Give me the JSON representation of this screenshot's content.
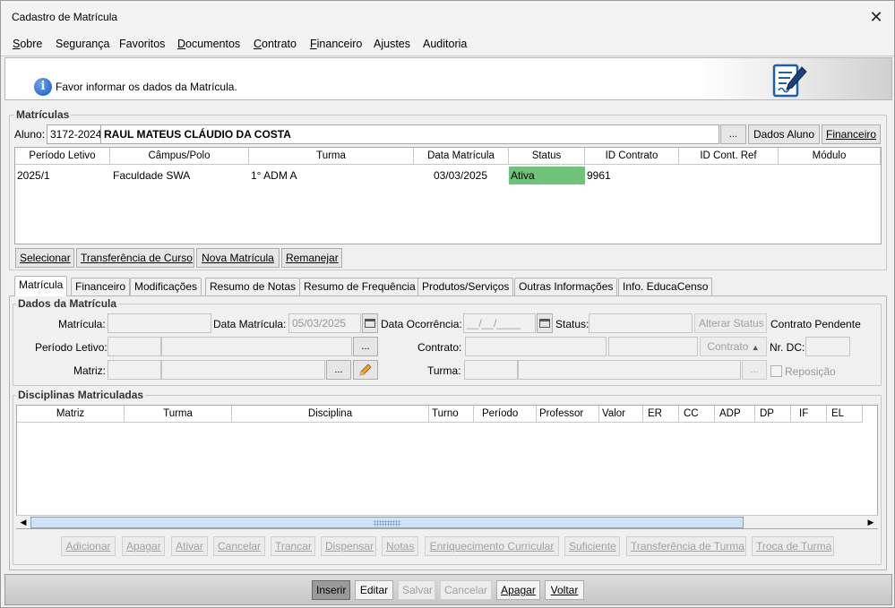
{
  "window": {
    "title": "Cadastro de Matrícula",
    "close_glyph": "✕"
  },
  "menu": [
    {
      "pre": "",
      "u": "S",
      "post": "obre"
    },
    {
      "pre": "Segurança",
      "u": "",
      "post": ""
    },
    {
      "pre": "Favoritos",
      "u": "",
      "post": ""
    },
    {
      "pre": "",
      "u": "D",
      "post": "ocumentos"
    },
    {
      "pre": "",
      "u": "C",
      "post": "ontrato"
    },
    {
      "pre": "",
      "u": "F",
      "post": "inanceiro"
    },
    {
      "pre": "Ajustes",
      "u": "",
      "post": ""
    },
    {
      "pre": "Auditoria",
      "u": "",
      "post": ""
    }
  ],
  "banner": {
    "info_glyph": "i",
    "message": "Favor informar os dados da Matrícula."
  },
  "matriculas": {
    "group_title": "Matrículas",
    "aluno_label": "Aluno:",
    "aluno_code": "3172-2024",
    "aluno_name": "RAUL MATEUS CLÁUDIO DA COSTA",
    "ellipsis": "...",
    "dados_aluno": "Dados Aluno",
    "financeiro_btn": "Financeiro",
    "columns": [
      "Período Letivo",
      "Câmpus/Polo",
      "Turma",
      "Data Matrícula",
      "Status",
      "ID Contrato",
      "ID Cont. Ref",
      "Módulo"
    ],
    "rows": [
      {
        "periodo": "2025/1",
        "campus": "Faculdade SWA",
        "turma": "1° ADM A",
        "data": "03/03/2025",
        "status": "Ativa",
        "id_contrato": "9961",
        "id_ref": "",
        "modulo": ""
      }
    ],
    "status_color": "#70c27a",
    "buttons": {
      "selecionar": "Selecionar",
      "transferencia": "Transferência de Curso",
      "nova": "Nova Matrícula",
      "remanejar": "Remanejar"
    }
  },
  "tabs": [
    "Matrícula",
    "Financeiro",
    "Modificações",
    "Resumo de Notas",
    "Resumo de Frequência",
    "Produtos/Serviços",
    "Outras Informações",
    "Info. EducaCenso"
  ],
  "dados": {
    "group_title": "Dados da Matrícula",
    "matricula_label": "Matrícula:",
    "data_matricula_label": "Data Matrícula:",
    "data_matricula_value": "05/03/2025",
    "data_ocorrencia_label": "Data Ocorrência:",
    "data_ocorrencia_value": "__/__/____",
    "status_label": "Status:",
    "alterar_status": "Alterar Status",
    "contrato_pendente": "Contrato Pendente",
    "periodo_label": "Período Letivo:",
    "contrato_label": "Contrato:",
    "contrato_btn": "Contrato",
    "nr_dc_label": "Nr. DC:",
    "matriz_label": "Matriz:",
    "turma_label": "Turma:",
    "reposicao_label": "Reposição",
    "ellipsis": "..."
  },
  "disciplinas": {
    "group_title": "Disciplinas Matriculadas",
    "columns": [
      "Matriz",
      "Turma",
      "Disciplina",
      "Turno",
      "Período",
      "Professor",
      "Valor",
      "ER",
      "CC",
      "ADP",
      "DP",
      "IF",
      "EL"
    ],
    "buttons": [
      "Adicionar",
      "Apagar",
      "Ativar",
      "Cancelar",
      "Trancar",
      "Dispensar",
      "Notas",
      "Enriquecimento Curricular",
      "Suficiente",
      "Transferência de Turma",
      "Troca de Turma"
    ]
  },
  "footer": {
    "inserir": "Inserir",
    "editar": "Editar",
    "salvar": "Salvar",
    "cancelar": "Cancelar",
    "apagar": "Apagar",
    "voltar": "Voltar"
  }
}
